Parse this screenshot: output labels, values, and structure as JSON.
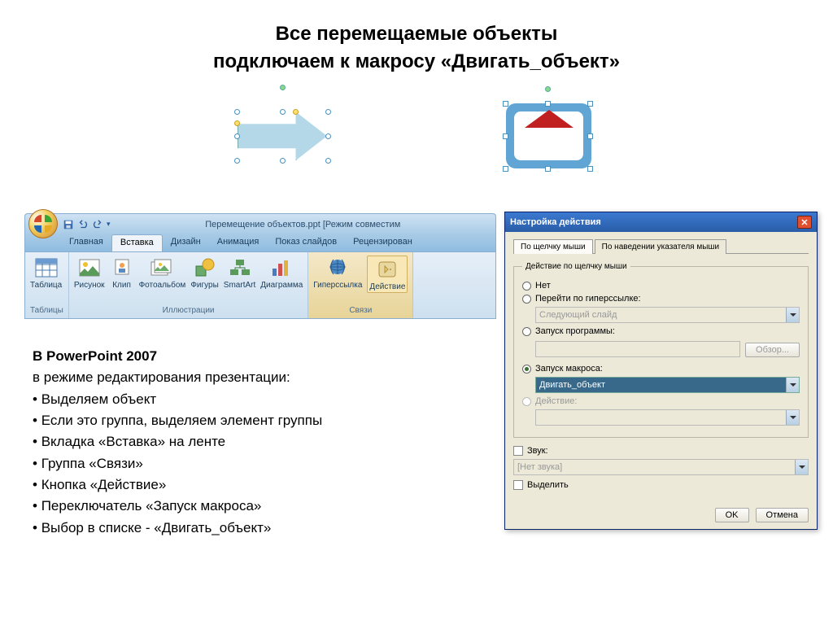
{
  "title_line1": "Все перемещаемые объекты",
  "title_line2": "подключаем к макросу «Двигать_объект»",
  "ribbon": {
    "doc_title": "Перемещение объектов.ppt [Режим совместим",
    "tabs": [
      "Главная",
      "Вставка",
      "Дизайн",
      "Анимация",
      "Показ слайдов",
      "Рецензирован"
    ],
    "active_tab": 1,
    "groups": {
      "tables": {
        "title": "Таблицы",
        "item": "Таблица"
      },
      "illustrations": {
        "title": "Иллюстрации",
        "items": [
          "Рисунок",
          "Клип",
          "Фотоальбом",
          "Фигуры",
          "SmartArt",
          "Диаграмма"
        ]
      },
      "links": {
        "title": "Связи",
        "items": [
          "Гиперссылка",
          "Действие"
        ]
      }
    }
  },
  "dialog": {
    "title": "Настройка действия",
    "tabs": [
      "По щелчку мыши",
      "По наведении указателя мыши"
    ],
    "fieldset": "Действие по щелчку мыши",
    "opt_none": "Нет",
    "opt_hyperlink": "Перейти по гиперссылке:",
    "hyperlink_value": "Следующий слайд",
    "opt_program": "Запуск программы:",
    "browse": "Обзор...",
    "opt_macro": "Запуск макроса:",
    "macro_value": "Двигать_объект",
    "opt_action": "Действие:",
    "sound_check": "Звук:",
    "sound_value": "[Нет звука]",
    "highlight_check": "Выделить",
    "ok": "OK",
    "cancel": "Отмена"
  },
  "instructions": {
    "header": "В PowerPoint 2007",
    "subheader": "в режиме редактирования презентации:",
    "bullets": [
      "Выделяем объект",
      "Если это группа, выделяем элемент группы",
      "Вкладка «Вставка» на ленте",
      "Группа «Связи»",
      "Кнопка «Действие»",
      "Переключатель «Запуск макроса»",
      "Выбор в списке - «Двигать_объект»"
    ]
  }
}
